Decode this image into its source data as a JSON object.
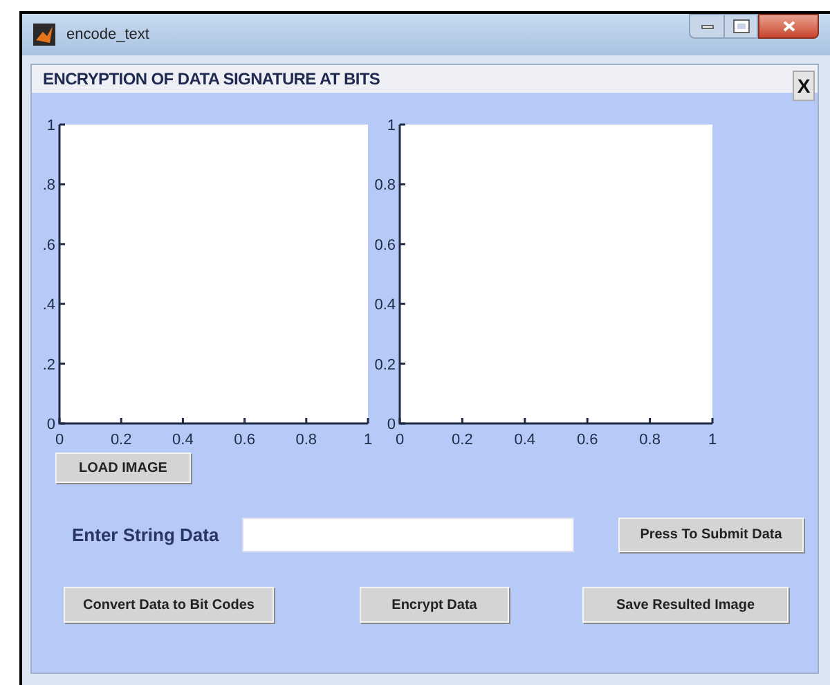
{
  "window": {
    "title": "encode_text"
  },
  "panel": {
    "title": "ENCRYPTION OF DATA SIGNATURE AT BITS",
    "close_label": "X"
  },
  "axes": [
    {
      "chart_data": {
        "type": "line",
        "xlim": [
          0,
          1
        ],
        "ylim": [
          0,
          1
        ],
        "xticks": [
          0,
          0.2,
          0.4,
          0.6,
          0.8,
          1
        ],
        "yticks": [
          0,
          {
            "value": 0.2,
            "label": ".2"
          },
          {
            "value": 0.4,
            "label": ".4"
          },
          {
            "value": 0.6,
            "label": ".6"
          },
          {
            "value": 0.8,
            "label": ".8"
          },
          1
        ]
      }
    },
    {
      "chart_data": {
        "type": "line",
        "xlim": [
          0,
          1
        ],
        "ylim": [
          0,
          1
        ],
        "xticks": [
          0,
          0.2,
          0.4,
          0.6,
          0.8,
          1
        ],
        "yticks": [
          0,
          0.2,
          0.4,
          0.6,
          0.8,
          1
        ]
      }
    }
  ],
  "load_button": "LOAD IMAGE",
  "string_input": {
    "label": "Enter String Data"
  },
  "submit_button": "Press To Submit Data",
  "action_buttons": [
    "Convert Data to Bit Codes",
    "Encrypt Data",
    "Save Resulted Image"
  ]
}
